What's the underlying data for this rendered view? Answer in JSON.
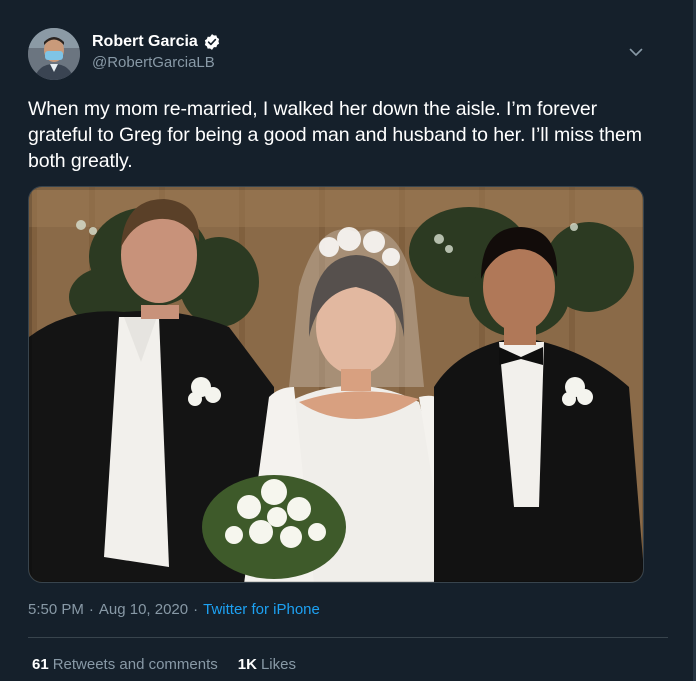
{
  "author": {
    "display_name": "Robert Garcia",
    "handle": "@RobertGarciaLB",
    "verified": true,
    "avatar_icon": "avatar-photo"
  },
  "tweet": {
    "text": "When my mom re-married, I walked her down the aisle. I’m forever grateful to Greg for being a good man and husband to her. I’ll miss them both greatly.",
    "photo_icon": "wedding-photo"
  },
  "meta": {
    "time": "5:50 PM",
    "separator1": "·",
    "date": "Aug 10, 2020",
    "separator2": "·",
    "source": "Twitter for iPhone"
  },
  "stats": {
    "retweets_count": "61",
    "retweets_label": "Retweets and comments",
    "likes_count": "1K",
    "likes_label": "Likes"
  },
  "colors": {
    "background": "#15202b",
    "secondary_text": "#8899a6",
    "accent": "#1da1f2",
    "divider": "#38444d"
  }
}
